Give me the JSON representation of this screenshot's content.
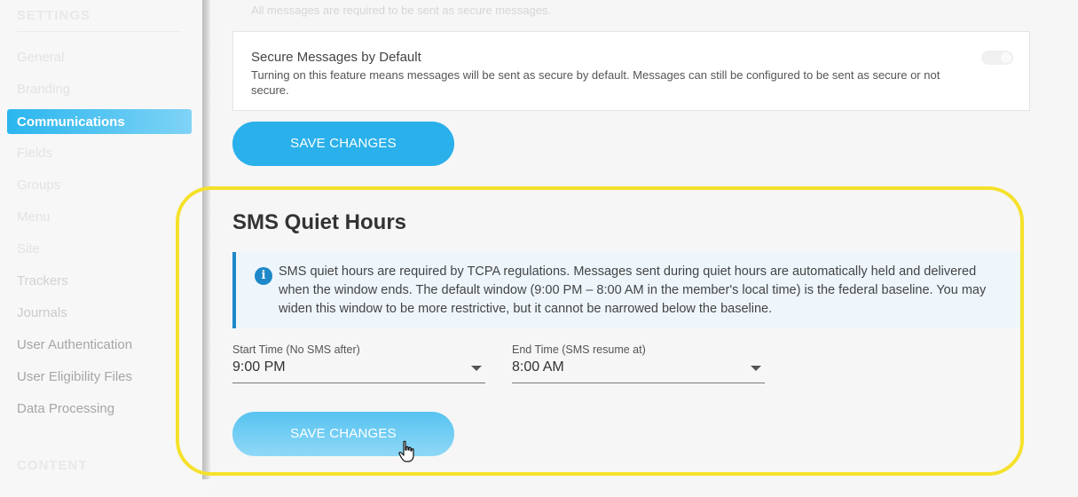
{
  "sidebar": {
    "settings_heading": "SETTINGS",
    "items": [
      {
        "label": "General"
      },
      {
        "label": "Branding"
      },
      {
        "label": "Communications",
        "active": true
      },
      {
        "label": "Fields"
      },
      {
        "label": "Groups"
      },
      {
        "label": "Menu"
      },
      {
        "label": "Site"
      },
      {
        "label": "Trackers"
      },
      {
        "label": "Journals"
      },
      {
        "label": "User Authentication"
      },
      {
        "label": "User Eligibility Files"
      },
      {
        "label": "Data Processing"
      }
    ],
    "content_heading": "CONTENT"
  },
  "secure_messages": {
    "top_note": "All messages are required to be sent as secure messages.",
    "title": "Secure Messages by Default",
    "description": "Turning on this feature means messages will be sent as secure by default. Messages can still be configured to be sent as secure or not secure.",
    "toggle_on": false,
    "save_label": "SAVE CHANGES"
  },
  "quiet_hours": {
    "title": "SMS Quiet Hours",
    "info_text": "SMS quiet hours are required by TCPA regulations. Messages sent during quiet hours are automatically held and delivered when the window ends. The default window (9:00 PM – 8:00 AM in the member's local time) is the federal baseline. You may widen this window to be more restrictive, but it cannot be narrowed below the baseline.",
    "start": {
      "label": "Start Time (No SMS after)",
      "value": "9:00 PM"
    },
    "end": {
      "label": "End Time (SMS resume at)",
      "value": "8:00 AM"
    },
    "save_label": "SAVE CHANGES"
  },
  "colors": {
    "accent": "#2ab0ea",
    "highlight": "#f5e12a",
    "info_border": "#1e88c8"
  },
  "icons": {
    "info": "info-icon",
    "cursor": "hand-pointer-icon",
    "caret": "chevron-down-icon"
  }
}
